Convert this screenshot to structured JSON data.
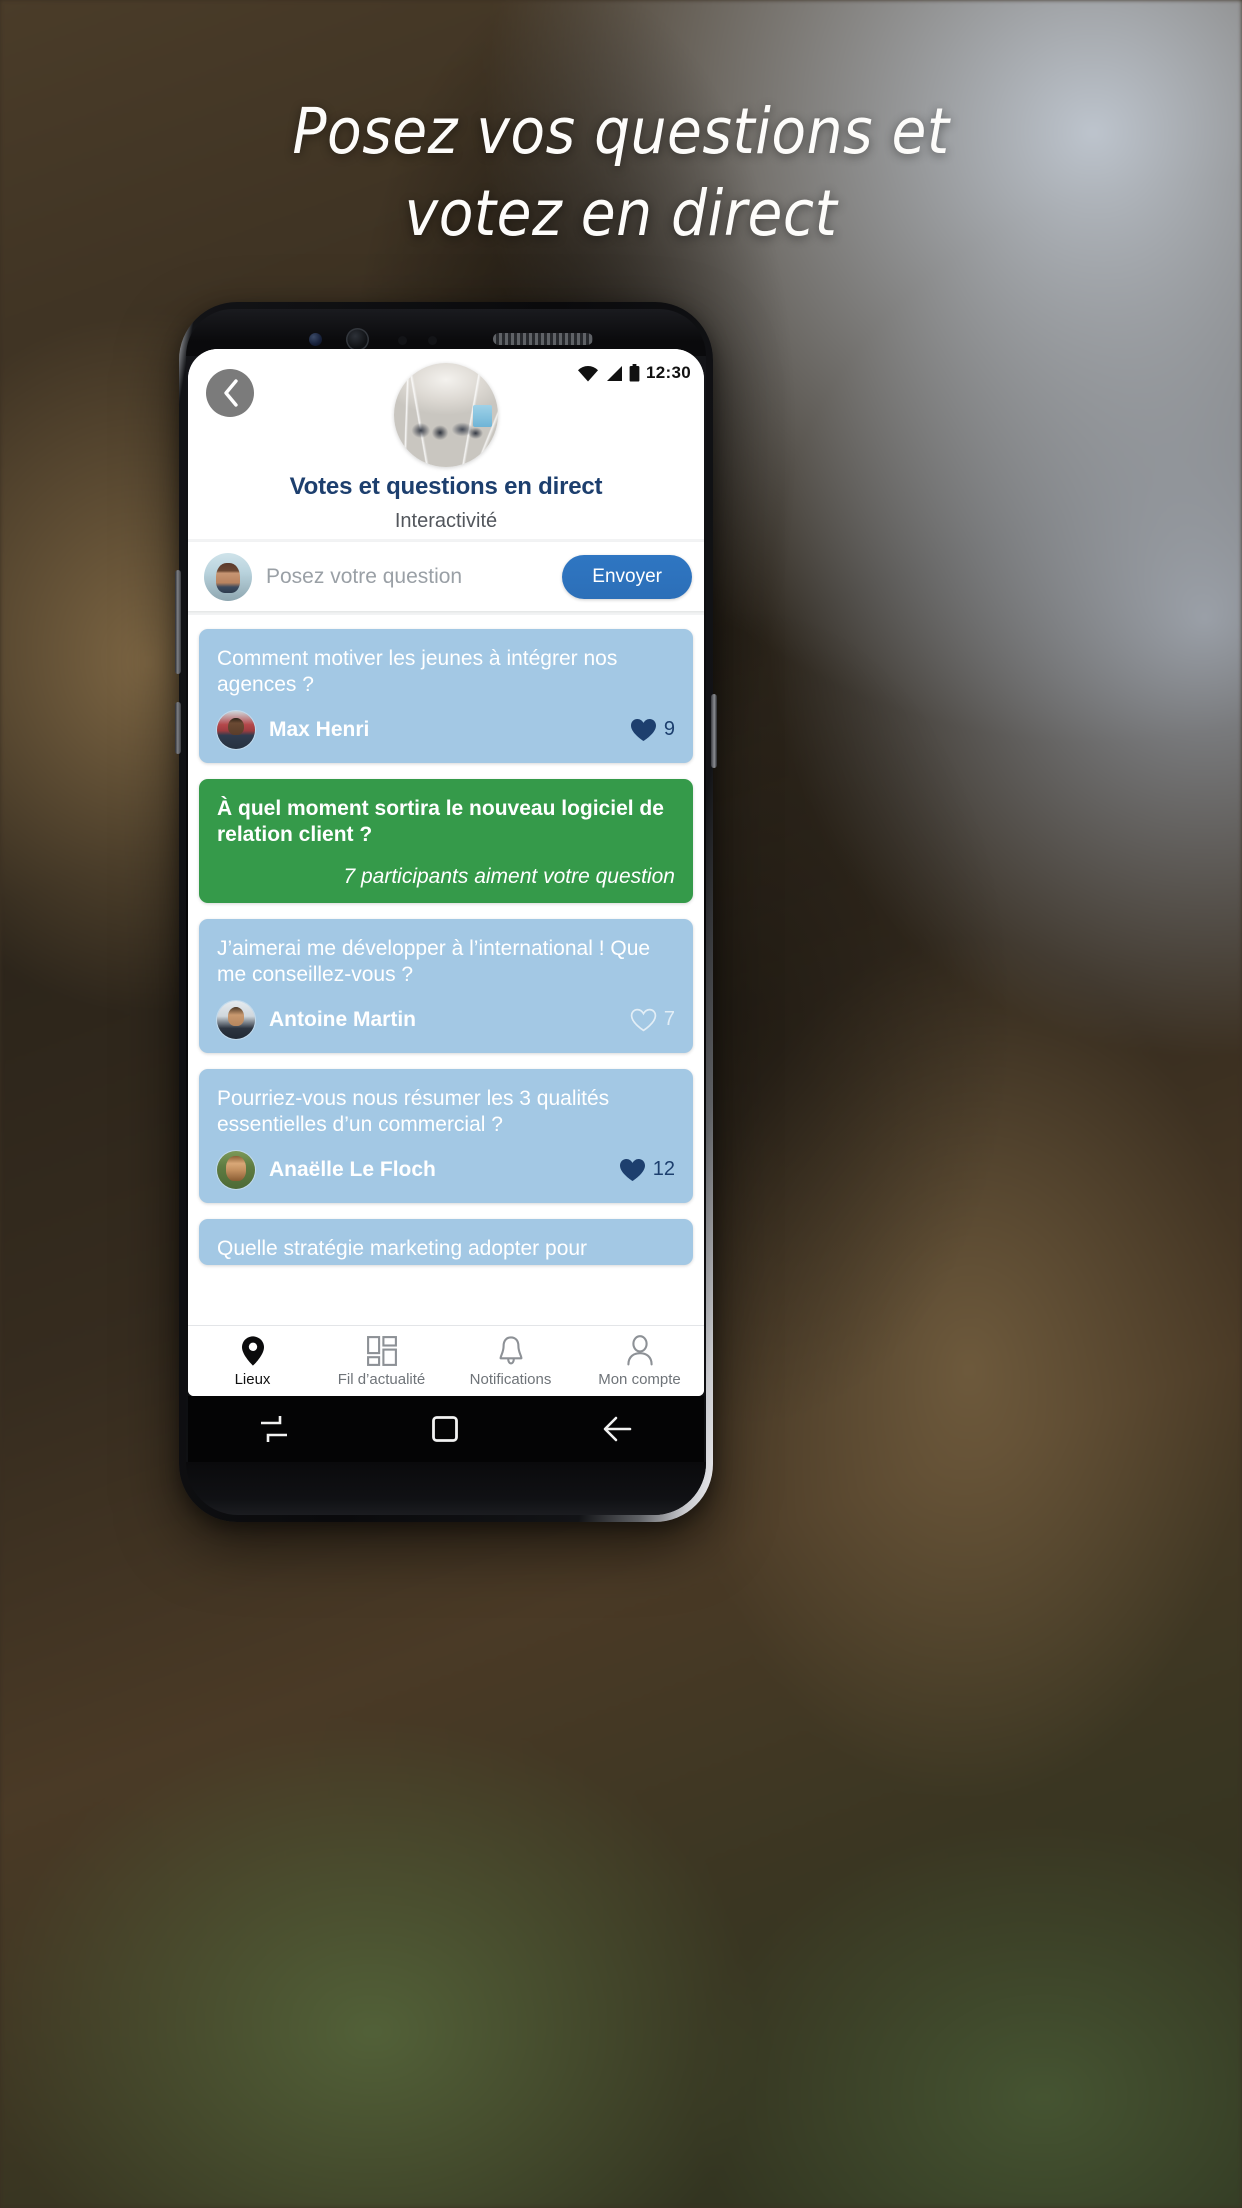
{
  "headline": {
    "line1": "Posez vos questions et",
    "line2": "votez en direct"
  },
  "statusbar": {
    "time": "12:30",
    "icons": [
      "wifi-icon",
      "signal-icon",
      "battery-icon"
    ]
  },
  "header": {
    "back_icon": "chevron-left-icon",
    "event_avatar": "event-photo-avatar",
    "title": "Votes et questions en direct",
    "subtitle": "Interactivité"
  },
  "ask_bar": {
    "avatar": "user-avatar",
    "placeholder": "Posez votre question",
    "value": "",
    "send_label": "Envoyer"
  },
  "feed": {
    "cards": [
      {
        "text": "Comment motiver les jeunes à intégrer nos agences ?",
        "author": "Max Henri",
        "likes": "9",
        "liked": true,
        "variant": "blue"
      },
      {
        "text": "À quel moment sortira le nouveau logiciel de relation client ?",
        "note": "7 participants aiment votre question",
        "variant": "green"
      },
      {
        "text": "J’aimerai me développer à l’international ! Que me conseillez-vous ?",
        "author": "Antoine Martin",
        "likes": "7",
        "liked": false,
        "variant": "blue"
      },
      {
        "text": "Pourriez-vous nous résumer les 3 qualités essentielles d’un commercial ?",
        "author": "Anaëlle Le Floch",
        "likes": "12",
        "liked": true,
        "variant": "blue"
      },
      {
        "text": "Quelle stratégie marketing adopter pour",
        "variant": "blue",
        "partial": true
      }
    ]
  },
  "tabbar": {
    "items": [
      {
        "label": "Lieux",
        "icon": "map-pin-icon",
        "active": true
      },
      {
        "label": "Fil d’actualité",
        "icon": "grid-icon",
        "active": false
      },
      {
        "label": "Notifications",
        "icon": "bell-icon",
        "active": false
      },
      {
        "label": "Mon compte",
        "icon": "person-icon",
        "active": false
      }
    ]
  },
  "android_nav": {
    "recents_icon": "recents-icon",
    "home_icon": "home-square-icon",
    "back_icon": "arrow-left-icon"
  },
  "colors": {
    "title_navy": "#1d3f6e",
    "card_blue": "#a3c8e4",
    "card_green": "#359a4a",
    "send_blue": "#2c6fb8"
  }
}
